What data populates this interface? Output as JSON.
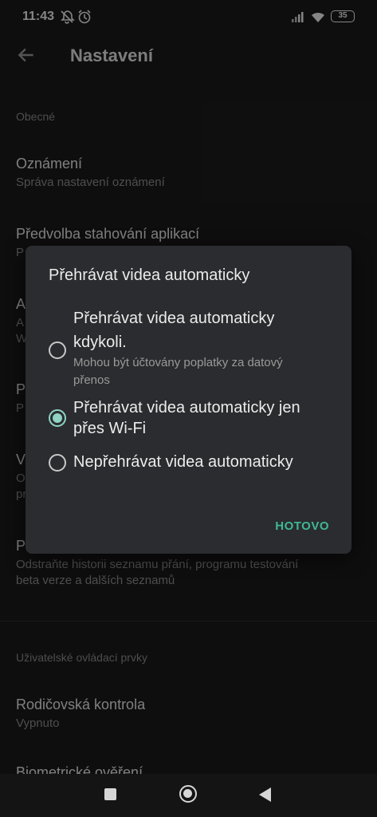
{
  "status_bar": {
    "time": "11:43",
    "battery": "35"
  },
  "header": {
    "title": "Nastavení"
  },
  "settings": {
    "section_general": "Obecné",
    "notifications": {
      "title": "Oznámení",
      "subtitle": "Správa nastavení oznámení"
    },
    "download_pref": {
      "title": "Předvolba stahování aplikací",
      "subtitle": "P"
    },
    "item_a": {
      "title": "A",
      "subtitle1": "A",
      "subtitle2": "W"
    },
    "item_p": {
      "title": "P",
      "subtitle": "P"
    },
    "item_v": {
      "title": "V",
      "subtitle1": "O",
      "subtitle2": "pr"
    },
    "item_history": {
      "title": "P",
      "subtitle1": "Odstraňte historii seznamu přání, programu testování",
      "subtitle2": "beta verze a dalších seznamů"
    },
    "section_user_controls": "Uživatelské ovládací prvky",
    "parental": {
      "title": "Rodičovská kontrola",
      "subtitle": "Vypnuto"
    },
    "biometric": {
      "title": "Biometrické ověření"
    }
  },
  "dialog": {
    "title": "Přehrávat videa automaticky",
    "options": [
      {
        "label_line1": "Přehrávat videa automaticky",
        "label_line2": "kdykoli.",
        "sub_line1": "Mohou být účtovány poplatky za datový",
        "sub_line2": "přenos",
        "selected": false
      },
      {
        "label_line1": "Přehrávat videa automaticky jen",
        "label_line2": "přes Wi-Fi",
        "selected": true
      },
      {
        "label_line1": "Nepřehrávat videa automaticky",
        "selected": false
      }
    ],
    "done_label": "HOTOVO"
  },
  "colors": {
    "accent": "#3fb894",
    "radio_selected": "#8fd3c4",
    "background": "#1b1b1b",
    "dialog": "#2b2c2f"
  },
  "icons": {
    "back": "arrow-back-icon",
    "alarm_off": "alarm-off-icon",
    "alarm": "alarm-icon",
    "signal": "signal-icon",
    "wifi": "wifi-icon",
    "battery": "battery-icon"
  }
}
